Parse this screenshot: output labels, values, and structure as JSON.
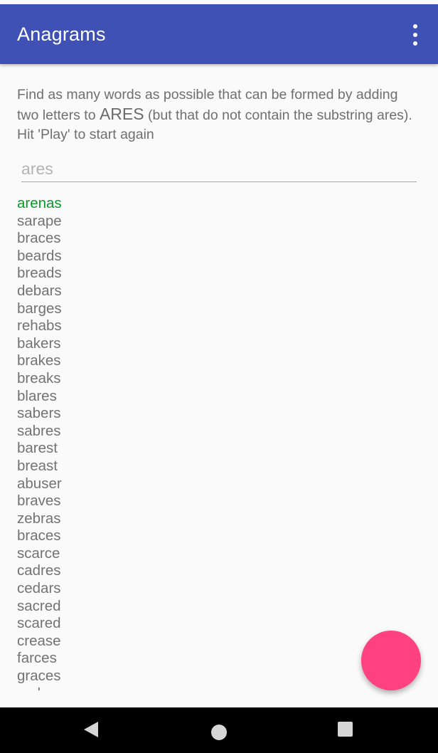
{
  "app_bar": {
    "title": "Anagrams",
    "overflow_icon": "more-vert-icon",
    "color": "#3f51b5"
  },
  "instructions": {
    "part1": "Find as many words as possible that can be formed by adding two letters to ",
    "target_word": "ARES",
    "part2": " (but that do not contain the substring ares). Hit 'Play' to start again"
  },
  "guess_input": {
    "value": "",
    "placeholder": "ares"
  },
  "words": [
    {
      "text": "arenas",
      "found": true
    },
    {
      "text": "sarape",
      "found": false
    },
    {
      "text": "braces",
      "found": false
    },
    {
      "text": "beards",
      "found": false
    },
    {
      "text": "breads",
      "found": false
    },
    {
      "text": "debars",
      "found": false
    },
    {
      "text": "barges",
      "found": false
    },
    {
      "text": "rehabs",
      "found": false
    },
    {
      "text": "bakers",
      "found": false
    },
    {
      "text": "brakes",
      "found": false
    },
    {
      "text": "breaks",
      "found": false
    },
    {
      "text": "blares",
      "found": false
    },
    {
      "text": "sabers",
      "found": false
    },
    {
      "text": "sabres",
      "found": false
    },
    {
      "text": "barest",
      "found": false
    },
    {
      "text": "breast",
      "found": false
    },
    {
      "text": "abuser",
      "found": false
    },
    {
      "text": "braves",
      "found": false
    },
    {
      "text": "zebras",
      "found": false
    },
    {
      "text": "braces",
      "found": false
    },
    {
      "text": "scarce",
      "found": false
    },
    {
      "text": "cadres",
      "found": false
    },
    {
      "text": "cedars",
      "found": false
    },
    {
      "text": "sacred",
      "found": false
    },
    {
      "text": "scared",
      "found": false
    },
    {
      "text": "crease",
      "found": false
    },
    {
      "text": "farces",
      "found": false
    },
    {
      "text": "graces",
      "found": false
    },
    {
      "text": "arches",
      "found": false
    }
  ],
  "colors": {
    "found_word": "#0a9a2a",
    "unfound_word": "#737373",
    "fab": "#ff4081"
  },
  "fab": {
    "icon": "play-icon"
  },
  "nav_bar": {
    "back_icon": "back-icon",
    "home_icon": "home-icon",
    "recents_icon": "recents-icon"
  }
}
